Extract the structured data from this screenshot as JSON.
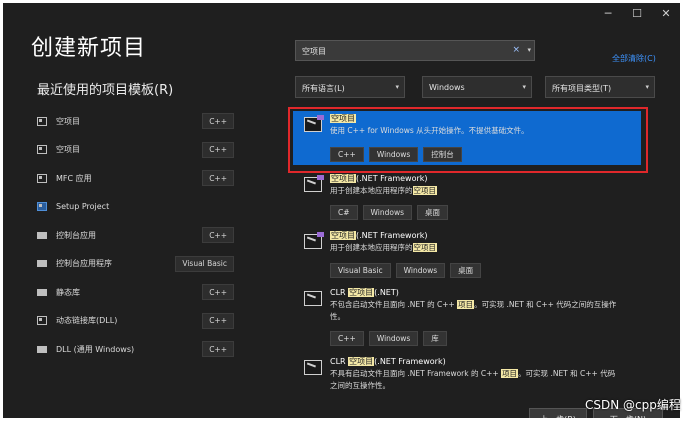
{
  "window": {
    "minimize": "─",
    "maximize": "☐",
    "close": "✕"
  },
  "title": "创建新项目",
  "recent_heading": "最近使用的项目模板(R)",
  "recent": [
    {
      "label": "空项目",
      "tag": "C++",
      "icon": "project-icon"
    },
    {
      "label": "空项目",
      "tag": "C++",
      "icon": "project-icon"
    },
    {
      "label": "MFC 应用",
      "tag": "C++",
      "icon": "project-icon"
    },
    {
      "label": "Setup Project",
      "tag": "",
      "icon": "setup-icon"
    },
    {
      "label": "控制台应用",
      "tag": "C++",
      "icon": "folder-icon"
    },
    {
      "label": "控制台应用程序",
      "tag": "Visual Basic",
      "icon": "folder-icon"
    },
    {
      "label": "静态库",
      "tag": "C++",
      "icon": "folder-icon"
    },
    {
      "label": "动态链接库(DLL)",
      "tag": "C++",
      "icon": "project-icon"
    },
    {
      "label": "DLL (通用 Windows)",
      "tag": "C++",
      "icon": "folder-icon"
    }
  ],
  "search": {
    "value": "空项目",
    "clear": "×",
    "arrow": "▾"
  },
  "clear_all": "全部清除(C)",
  "filters": [
    {
      "label": "所有语言(L)"
    },
    {
      "label": "Windows"
    },
    {
      "label": "所有项目类型(T)"
    }
  ],
  "filter_arrow": "▾",
  "templates": [
    {
      "name": "空项目",
      "desc": "使用 C++ for Windows 从头开始操作。不提供基础文件。",
      "tags": [
        "C++",
        "Windows",
        "控制台"
      ]
    },
    {
      "name_hl": "空项目",
      "name_rest": "(.NET Framework)",
      "desc_pre": "用于创建本地应用程序的",
      "desc_hl": "空项目",
      "tags": [
        "C#",
        "Windows",
        "桌面"
      ]
    },
    {
      "name_hl": "空项目",
      "name_rest": "(.NET Framework)",
      "desc_pre": "用于创建本地应用程序的",
      "desc_hl": "空项目",
      "tags": [
        "Visual Basic",
        "Windows",
        "桌面"
      ]
    },
    {
      "name_pre": "CLR ",
      "name_hl": "空项目",
      "name_rest": "(.NET)",
      "desc_l1a": "不包含启动文件且面向 .NET 的 C++ ",
      "desc_hl": "项目",
      "desc_l1b": "。可实现 .NET 和 C++ 代码之间的互操作",
      "desc_l2": "性。",
      "tags": [
        "C++",
        "Windows",
        "库"
      ]
    },
    {
      "name_pre": "CLR ",
      "name_hl": "空项目",
      "name_rest": "(.NET Framework)",
      "desc_l1a": "不具有启动文件且面向 .NET Framework 的 C++ ",
      "desc_hl": "项目",
      "desc_l1b": "。可实现 .NET 和 C++ 代码",
      "desc_l2": "之间的互操作性。"
    }
  ],
  "buttons": {
    "back": "上一步(B)",
    "next": "下一步(N)"
  },
  "watermark": "CSDN @cpp编程"
}
